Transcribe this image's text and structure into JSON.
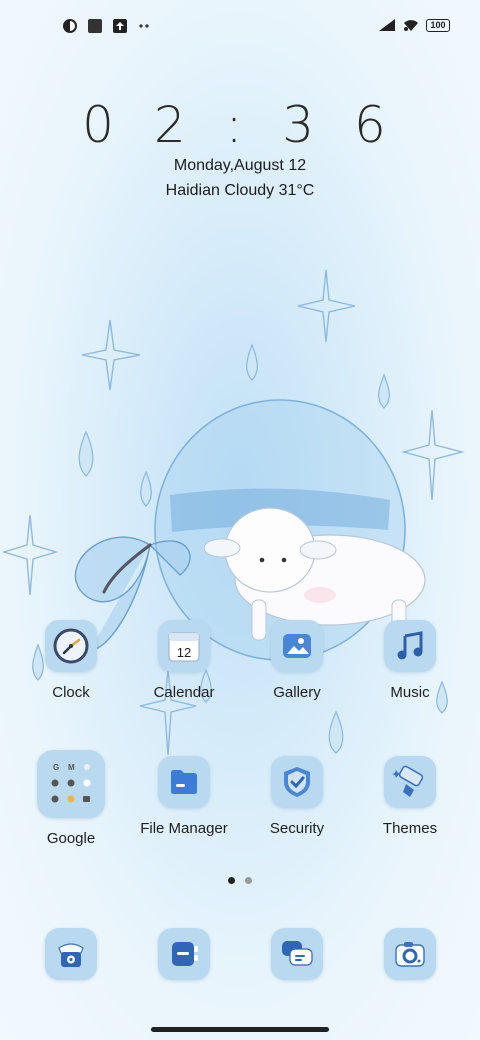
{
  "status_bar": {
    "left_icons": [
      "app-notification-icon",
      "square-notification-icon",
      "upload-icon",
      "more-dots-icon"
    ],
    "right_icons": [
      "signal-icon",
      "wifi-icon",
      "battery-icon"
    ],
    "battery_level": "100"
  },
  "lockclock": {
    "time": "0 2 : 3 6",
    "date": "Monday,August 12",
    "weather": "Haidian Cloudy 31°C"
  },
  "apps_row1": [
    {
      "label": "Clock",
      "icon": "clock-icon"
    },
    {
      "label": "Calendar",
      "icon": "calendar-icon",
      "badge": "12"
    },
    {
      "label": "Gallery",
      "icon": "gallery-icon"
    },
    {
      "label": "Music",
      "icon": "music-icon"
    }
  ],
  "apps_row2": [
    {
      "label": "Google",
      "icon": "google-folder-icon"
    },
    {
      "label": "File Manager",
      "icon": "file-manager-icon"
    },
    {
      "label": "Security",
      "icon": "security-shield-icon"
    },
    {
      "label": "Themes",
      "icon": "themes-brush-icon"
    }
  ],
  "page_indicator": {
    "pages": 2,
    "current": 1
  },
  "dock": [
    {
      "icon": "phone-icon"
    },
    {
      "icon": "contacts-icon"
    },
    {
      "icon": "messages-icon"
    },
    {
      "icon": "camera-icon"
    }
  ],
  "colors": {
    "accent": "#4a86d6",
    "icon_bg": "#b9d9f1"
  }
}
